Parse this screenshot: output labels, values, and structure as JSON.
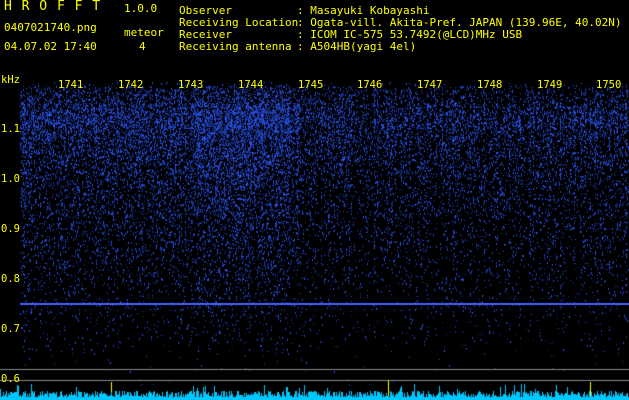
{
  "app": {
    "name": "H R O F F T",
    "version": "1.0.0"
  },
  "file": {
    "name": "0407021740.png",
    "datetime": "04.07.02 17:40"
  },
  "meteor": {
    "label": "meteor",
    "count": "4"
  },
  "info": [
    {
      "label": "Observer",
      "value": ": Masayuki Kobayashi"
    },
    {
      "label": "Receiving Location",
      "value": ": Ogata-vill. Akita-Pref. JAPAN (139.96E, 40.02N)"
    },
    {
      "label": "Receiver",
      "value": ": ICOM IC-575 53.7492(@LCD)MHz USB"
    },
    {
      "label": "Receiving antenna",
      "value": ": A504HB(yagi 4el)"
    }
  ],
  "axis": {
    "unit": "kHz",
    "freq_ticks": [
      "1.1",
      "1.0",
      "0.9",
      "0.8",
      "0.7",
      "0.6"
    ],
    "time_ticks": [
      "1741",
      "1742",
      "1743",
      "1744",
      "1745",
      "1746",
      "1747",
      "1748",
      "1749",
      "1750"
    ]
  },
  "colors": {
    "text": "#ffff00",
    "signal": "#2c46ff",
    "carrier": "#4a63ff",
    "hline": "#8a8a8a",
    "level": "#00c8ff",
    "marker": "#ffff00"
  }
}
